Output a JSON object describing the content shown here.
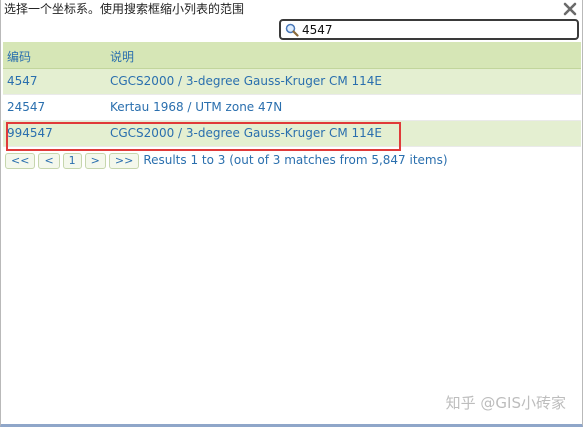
{
  "dialog": {
    "title": "选择一个坐标系。使用搜索框缩小列表的范围",
    "close_icon": "close-icon"
  },
  "search": {
    "icon": "search-icon",
    "value": "4547",
    "placeholder": ""
  },
  "grid": {
    "columns": [
      "编码",
      "说明"
    ],
    "rows": [
      {
        "code": "4547",
        "description": "CGCS2000 / 3-degree Gauss-Kruger CM 114E"
      },
      {
        "code": "24547",
        "description": "Kertau 1968 / UTM zone 47N"
      },
      {
        "code": "994547",
        "description": "CGCS2000 / 3-degree Gauss-Kruger CM 114E"
      }
    ]
  },
  "pager": {
    "first_label": "<<",
    "prev_label": "<",
    "page_label": "1",
    "next_label": ">",
    "last_label": ">>",
    "status": "Results 1 to 3 (out of 3 matches from 5,847 items)"
  },
  "watermark": "知乎 @GIS小砖家",
  "colors": {
    "header_bg": "#d6e6b6",
    "row_alt_bg": "#e4efd1",
    "link_text": "#2a6fae",
    "highlight": "#e03a3a"
  }
}
